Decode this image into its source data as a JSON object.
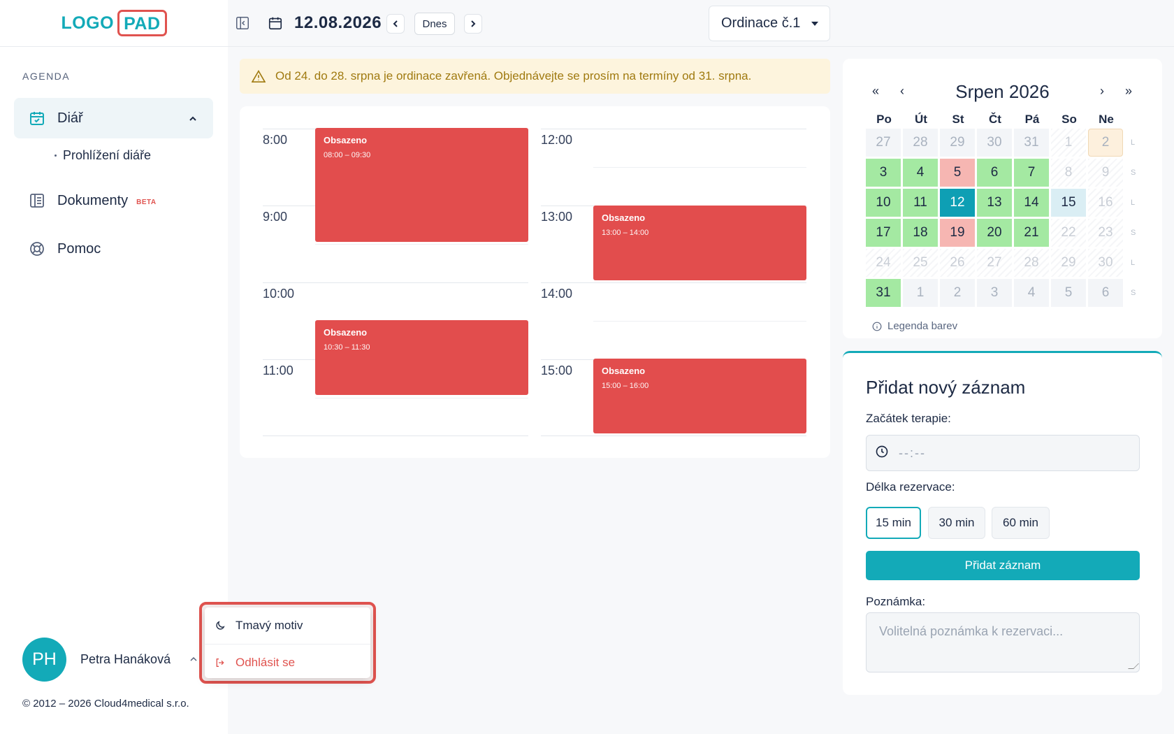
{
  "logo": {
    "part1": "LOGO",
    "part2": "PAD"
  },
  "sidebar": {
    "section_label": "AGENDA",
    "items": [
      {
        "label": "Diář",
        "icon": "calendar-check-icon"
      },
      {
        "label": "Dokumenty",
        "badge": "BETA",
        "icon": "book-icon"
      },
      {
        "label": "Pomoc",
        "icon": "lifebuoy-icon"
      }
    ],
    "subitem": "Prohlížení diáře",
    "user": {
      "initials": "PH",
      "name": "Petra Hanáková"
    },
    "copyright": "© 2012 – 2026 Cloud4medical s.r.o."
  },
  "user_menu": {
    "theme": "Tmavý motiv",
    "logout": "Odhlásit se"
  },
  "header": {
    "date": "12.08.2026",
    "today_label": "Dnes",
    "office": "Ordinace č.1"
  },
  "alert": {
    "text": "Od 24. do 28. srpna je ordinace zavřená. Objednávejte se prosím na termíny od 31. srpna."
  },
  "schedule": {
    "hours_left": [
      "8:00",
      "9:00",
      "10:00",
      "11:00"
    ],
    "hours_right": [
      "12:00",
      "13:00",
      "14:00",
      "15:00"
    ],
    "events": [
      {
        "title": "Obsazeno",
        "range": "08:00 – 09:30"
      },
      {
        "title": "Obsazeno",
        "range": "10:30 – 11:30"
      },
      {
        "title": "Obsazeno",
        "range": "13:00 – 14:00"
      },
      {
        "title": "Obsazeno",
        "range": "15:00 – 16:00"
      }
    ]
  },
  "calendar": {
    "nav": {
      "prev_year": "«",
      "prev_month": "‹",
      "next_month": "›",
      "next_year": "»"
    },
    "title": "Srpen 2026",
    "weekdays": [
      "Po",
      "Út",
      "St",
      "Čt",
      "Pá",
      "So",
      "Ne"
    ],
    "week_letters": [
      "L",
      "S",
      "L",
      "S",
      "L",
      "S"
    ],
    "weeks": [
      [
        {
          "d": "27",
          "s": "muted"
        },
        {
          "d": "28",
          "s": "muted"
        },
        {
          "d": "29",
          "s": "muted"
        },
        {
          "d": "30",
          "s": "muted"
        },
        {
          "d": "31",
          "s": "muted"
        },
        {
          "d": "1",
          "s": "hatch"
        },
        {
          "d": "2",
          "s": "orange"
        }
      ],
      [
        {
          "d": "3",
          "s": "green"
        },
        {
          "d": "4",
          "s": "green"
        },
        {
          "d": "5",
          "s": "red"
        },
        {
          "d": "6",
          "s": "green"
        },
        {
          "d": "7",
          "s": "green"
        },
        {
          "d": "8",
          "s": "hatch"
        },
        {
          "d": "9",
          "s": "hatch"
        }
      ],
      [
        {
          "d": "10",
          "s": "green"
        },
        {
          "d": "11",
          "s": "green"
        },
        {
          "d": "12",
          "s": "teal"
        },
        {
          "d": "13",
          "s": "green"
        },
        {
          "d": "14",
          "s": "green"
        },
        {
          "d": "15",
          "s": "light"
        },
        {
          "d": "16",
          "s": "hatch"
        }
      ],
      [
        {
          "d": "17",
          "s": "green"
        },
        {
          "d": "18",
          "s": "green"
        },
        {
          "d": "19",
          "s": "red"
        },
        {
          "d": "20",
          "s": "green"
        },
        {
          "d": "21",
          "s": "green"
        },
        {
          "d": "22",
          "s": "hatch"
        },
        {
          "d": "23",
          "s": "hatch"
        }
      ],
      [
        {
          "d": "24",
          "s": "hatch"
        },
        {
          "d": "25",
          "s": "hatch"
        },
        {
          "d": "26",
          "s": "hatch"
        },
        {
          "d": "27",
          "s": "hatch"
        },
        {
          "d": "28",
          "s": "hatch"
        },
        {
          "d": "29",
          "s": "hatch"
        },
        {
          "d": "30",
          "s": "hatch"
        }
      ],
      [
        {
          "d": "31",
          "s": "green"
        },
        {
          "d": "1",
          "s": "muted"
        },
        {
          "d": "2",
          "s": "muted"
        },
        {
          "d": "3",
          "s": "muted"
        },
        {
          "d": "4",
          "s": "muted"
        },
        {
          "d": "5",
          "s": "muted"
        },
        {
          "d": "6",
          "s": "muted"
        }
      ]
    ],
    "legend": "Legenda barev"
  },
  "form": {
    "title": "Přidat nový záznam",
    "start_label": "Začátek terapie:",
    "time_placeholder": "--:--",
    "duration_label": "Délka rezervace:",
    "durations": [
      "15 min",
      "30 min",
      "60 min"
    ],
    "selected_duration": "15 min",
    "submit": "Přidat záznam",
    "note_label": "Poznámka:",
    "note_placeholder": "Volitelná poznámka k rezervaci..."
  },
  "colors": {
    "accent": "#13aab8",
    "danger": "#e24d4d",
    "available": "#a4e9a2",
    "busy": "#f6b6b2"
  }
}
